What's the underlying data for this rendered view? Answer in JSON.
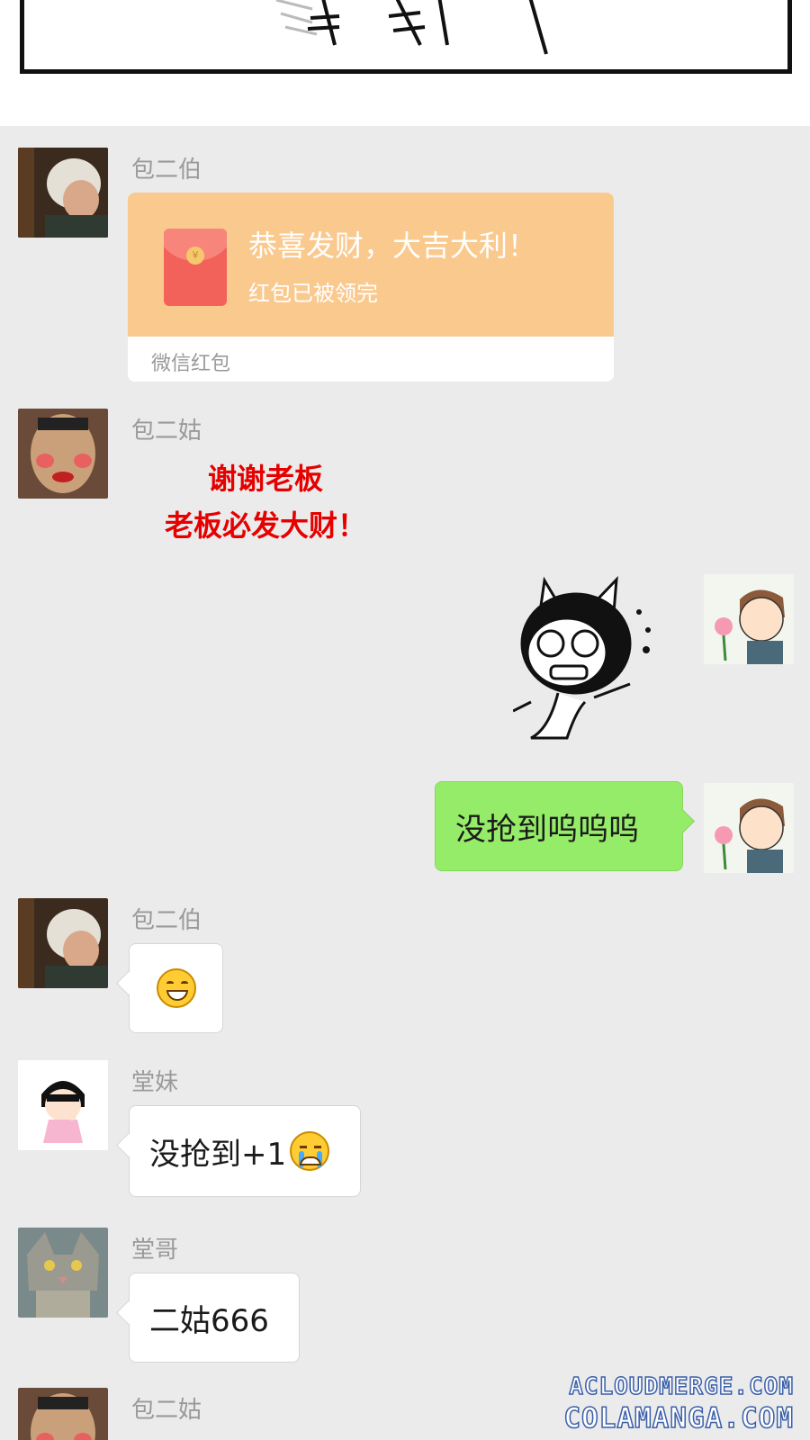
{
  "messages": {
    "m1": {
      "sender": "包二伯"
    },
    "red_packet": {
      "title": "恭喜发财，大吉大利！",
      "status": "红包已被领完",
      "footer": "微信红包",
      "coin_glyph": "¥"
    },
    "m2": {
      "sender": "包二姑",
      "line1": "谢谢老板",
      "line2": "老板必发大财！"
    },
    "m4": {
      "text": "没抢到呜呜呜"
    },
    "m5": {
      "sender": "包二伯"
    },
    "m6": {
      "sender": "堂妹",
      "text": "没抢到+1"
    },
    "m7": {
      "sender": "堂哥",
      "text": "二姑666"
    },
    "m8": {
      "sender": "包二姑"
    }
  },
  "watermark": {
    "line1": "ACLOUDMERGE.COM",
    "line2": "COLAMANGA.COM"
  },
  "colors": {
    "chat_bg": "#ebebeb",
    "own_bubble": "#95ec69",
    "red_packet": "#fac98e",
    "red_text": "#e60000"
  },
  "icons": [
    "grin-emoji-icon",
    "crying-emoji-icon",
    "red-envelope-icon"
  ]
}
